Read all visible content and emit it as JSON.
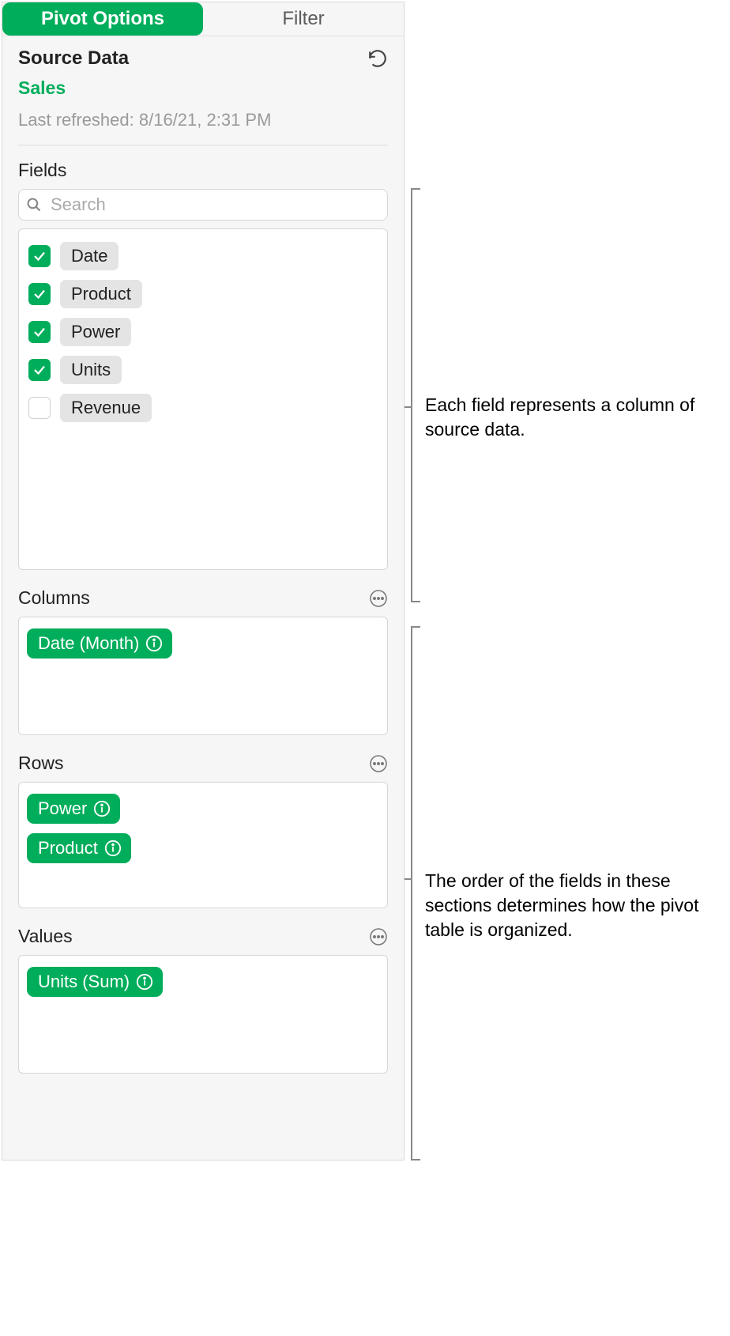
{
  "tabs": {
    "pivot": "Pivot Options",
    "filter": "Filter"
  },
  "source": {
    "title": "Source Data",
    "name": "Sales",
    "last_refreshed": "Last refreshed: 8/16/21, 2:31 PM"
  },
  "search": {
    "placeholder": "Search"
  },
  "fields_label": "Fields",
  "fields": [
    {
      "label": "Date",
      "checked": true
    },
    {
      "label": "Product",
      "checked": true
    },
    {
      "label": "Power",
      "checked": true
    },
    {
      "label": "Units",
      "checked": true
    },
    {
      "label": "Revenue",
      "checked": false
    }
  ],
  "sections": {
    "columns": {
      "label": "Columns",
      "items": [
        "Date (Month)"
      ]
    },
    "rows": {
      "label": "Rows",
      "items": [
        "Power",
        "Product"
      ]
    },
    "values": {
      "label": "Values",
      "items": [
        "Units (Sum)"
      ]
    }
  },
  "callouts": {
    "fields": "Each field represents a column of source data.",
    "sections": "The order of the fields in these sections determines how the pivot table is organized."
  },
  "colors": {
    "accent": "#00ad5b"
  }
}
